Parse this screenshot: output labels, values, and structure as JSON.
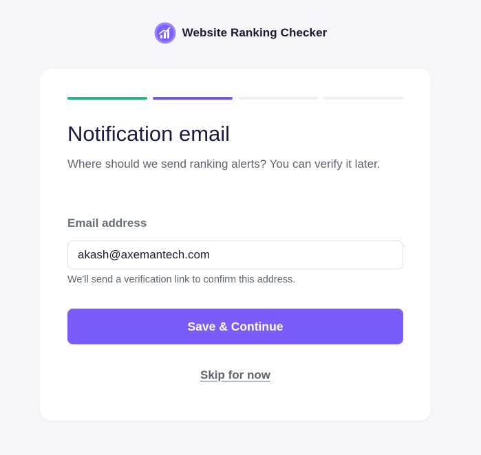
{
  "brand": {
    "name": "Website Ranking Checker",
    "logo_icon": "bar-chart-logo-icon",
    "logo_color": "#7b61ff"
  },
  "progress": {
    "steps": [
      {
        "state": "done",
        "color": "#2bb37e"
      },
      {
        "state": "active",
        "color": "#6f5ce0"
      },
      {
        "state": "pending",
        "color": "#eeeef5"
      },
      {
        "state": "pending",
        "color": "#eeeef5"
      }
    ]
  },
  "form": {
    "title": "Notification email",
    "subtitle": "Where should we send ranking alerts? You can verify it later.",
    "email_label": "Email address",
    "email_value": "akash@axemantech.com",
    "help_text": "We'll send a verification link to confirm this address.",
    "submit_label": "Save & Continue",
    "skip_label": "Skip for now"
  },
  "colors": {
    "primary": "#7a5cfa",
    "background": "#f6f6f9"
  }
}
